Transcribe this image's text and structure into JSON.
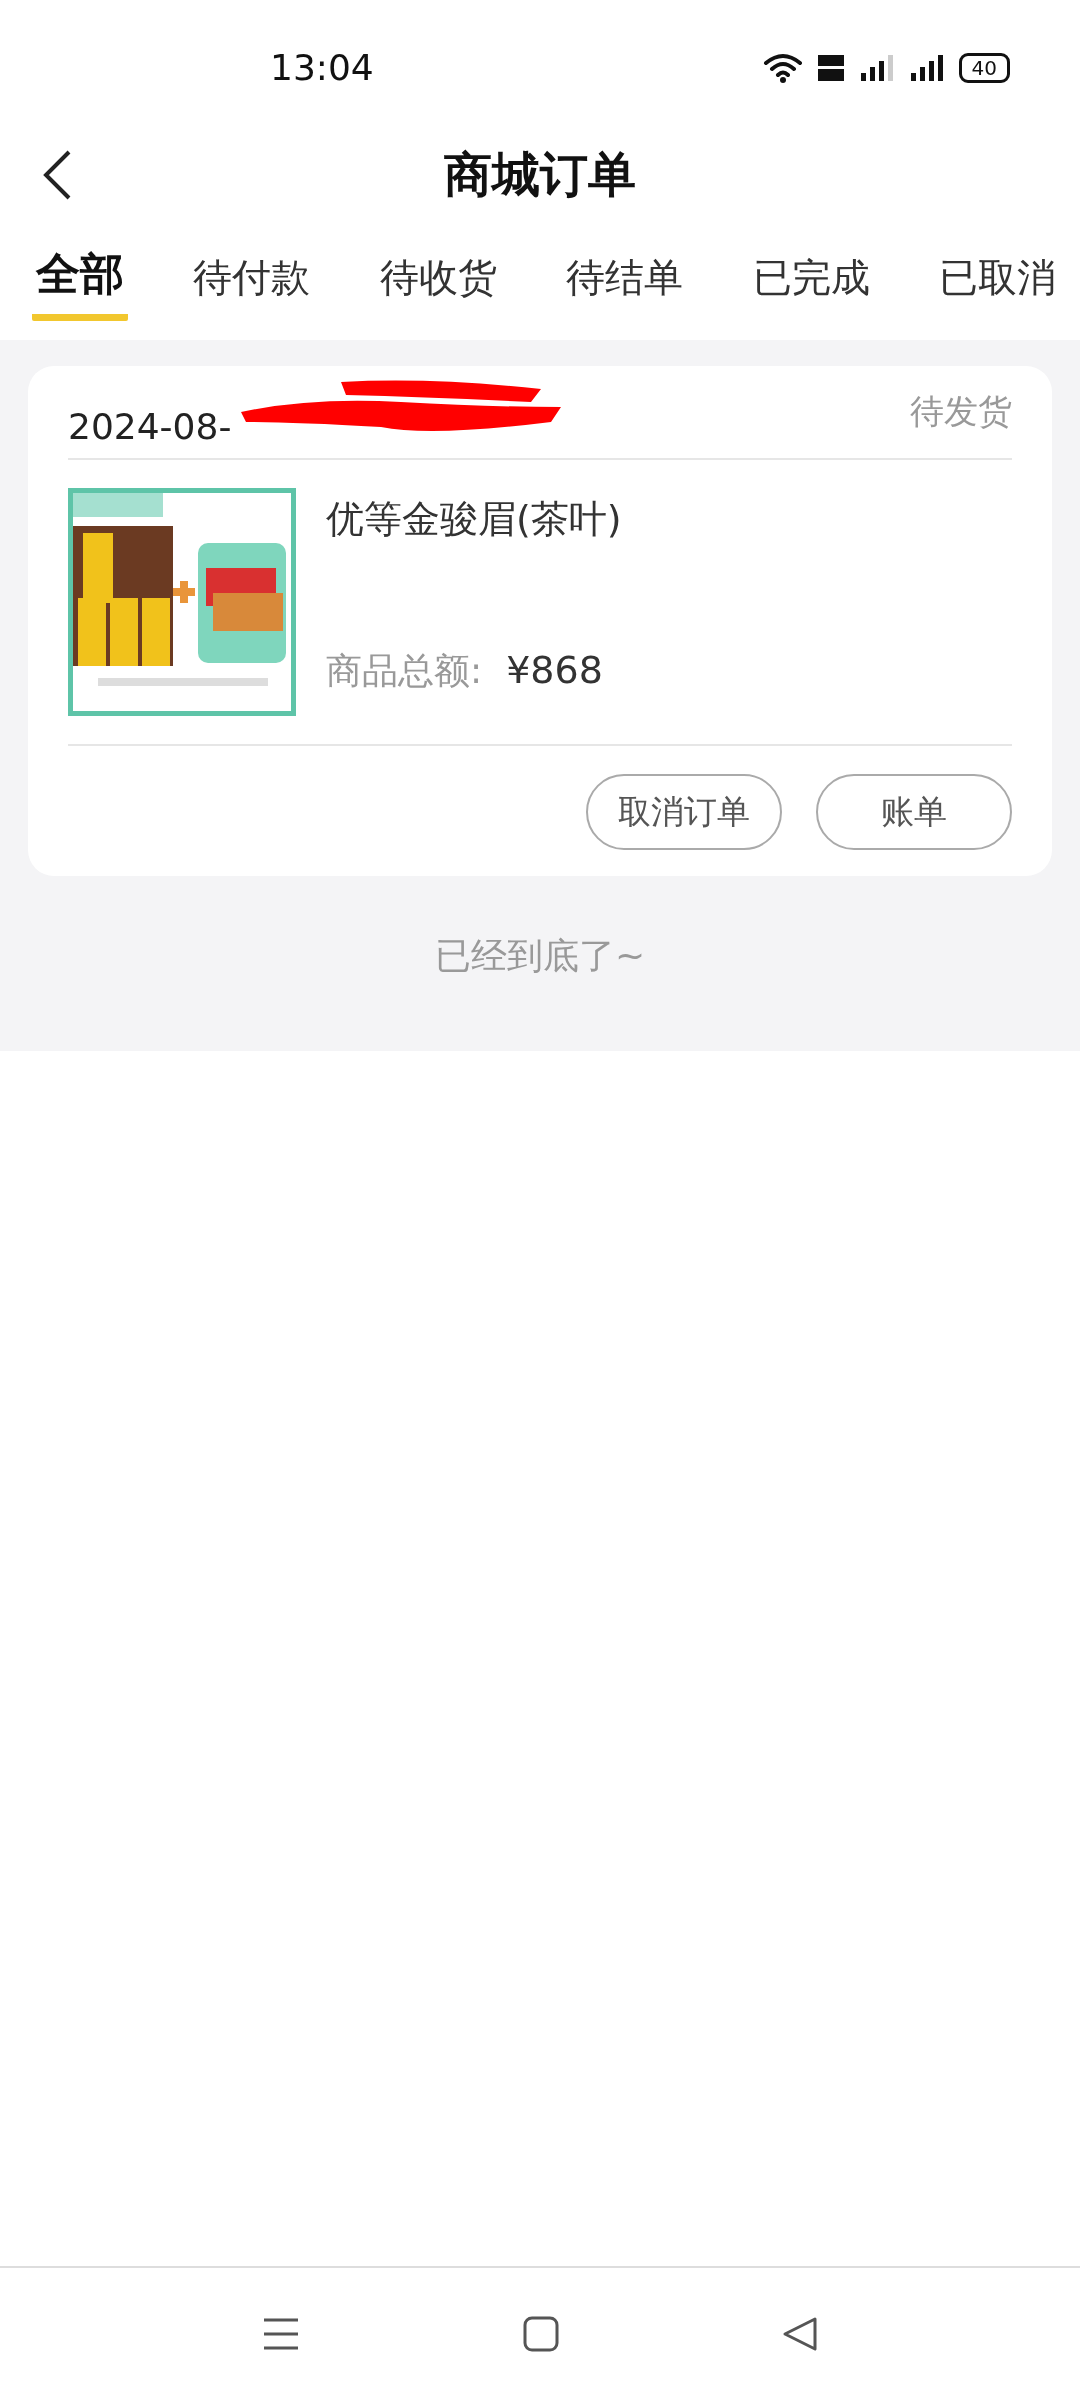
{
  "status_bar": {
    "time": "13:04",
    "battery": "40"
  },
  "header": {
    "title": "商城订单"
  },
  "tabs": [
    {
      "label": "全部",
      "selected": true
    },
    {
      "label": "待付款",
      "selected": false
    },
    {
      "label": "待收货",
      "selected": false
    },
    {
      "label": "待结单",
      "selected": false
    },
    {
      "label": "已完成",
      "selected": false
    },
    {
      "label": "已取消",
      "selected": false
    }
  ],
  "orders": [
    {
      "date": "2024-08-",
      "redacted": true,
      "status": "待发货",
      "product": {
        "kind": "picture",
        "name": "优等金骏眉(茶叶)",
        "total_label": "商品总额:",
        "total": "¥868"
      },
      "actions": [
        "取消订单",
        "账单"
      ]
    }
  ],
  "end_note": "已经到底了~"
}
